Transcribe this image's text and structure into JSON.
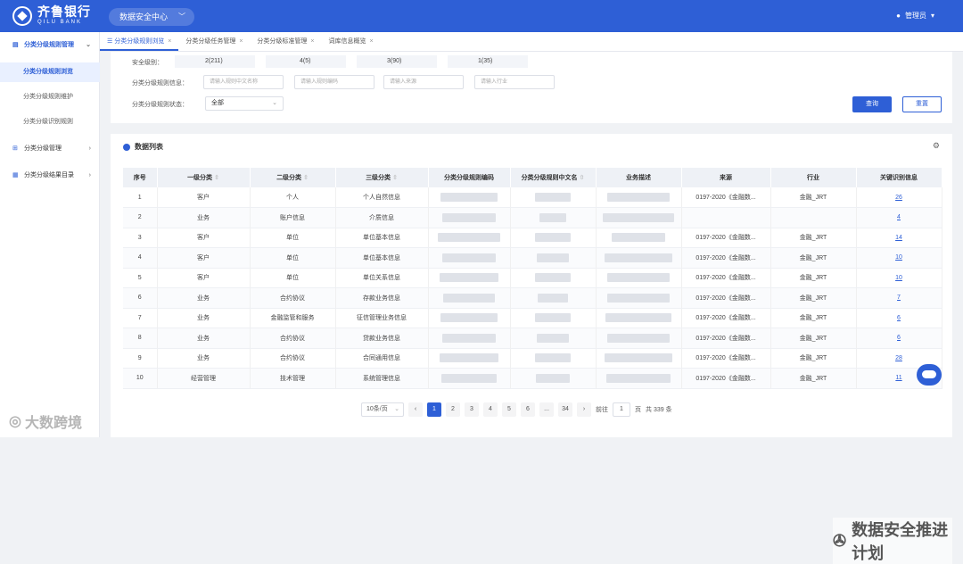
{
  "header": {
    "logo_cn": "齐鲁银行",
    "logo_en": "QILU BANK",
    "center_select": "数据安全中心",
    "user": "管理员"
  },
  "sidebar": {
    "items": [
      {
        "label": "分类分级规则管理",
        "type": "group",
        "open": true,
        "icon": "doc-icon"
      },
      {
        "label": "分类分级规则浏览",
        "type": "sub",
        "active": true
      },
      {
        "label": "分类分级规则维护",
        "type": "sub"
      },
      {
        "label": "分类分级识别规则",
        "type": "sub"
      },
      {
        "label": "分类分级管理",
        "type": "group",
        "icon": "grid-icon"
      },
      {
        "label": "分类分级结果目录",
        "type": "group",
        "icon": "list-icon"
      }
    ]
  },
  "tabs": [
    {
      "label": "分类分级规则浏览",
      "active": true
    },
    {
      "label": "分类分级任务管理"
    },
    {
      "label": "分类分级标准管理"
    },
    {
      "label": "词库信息概览"
    }
  ],
  "filter": {
    "level_label": "安全级别：",
    "levels": [
      "2(211)",
      "4(5)",
      "3(90)",
      "1(35)"
    ],
    "info_label": "分类分级规则信息：",
    "placeholders": [
      "请输入规则中文名称",
      "请输入规则编码",
      "请输入来源",
      "请输入行业"
    ],
    "status_label": "分类分级规则状态：",
    "status_value": "全部",
    "query_button": "查询",
    "reset_button": "重置"
  },
  "list": {
    "title": "数据列表",
    "columns": [
      "序号",
      "一级分类",
      "二级分类",
      "三级分类",
      "分类分级规则编码",
      "分类分级规则中文名",
      "业务描述",
      "来源",
      "行业",
      "关键识别信息"
    ],
    "rows": [
      {
        "no": "1",
        "l1": "客户",
        "l2": "个人",
        "l3": "个人自然信息",
        "source": "0197-2020《金融数...",
        "industry": "金融_JRT",
        "key": "26"
      },
      {
        "no": "2",
        "l1": "业务",
        "l2": "账户信息",
        "l3": "介质信息",
        "source": "",
        "industry": "",
        "key": "4"
      },
      {
        "no": "3",
        "l1": "客户",
        "l2": "单位",
        "l3": "单位基本信息",
        "source": "0197-2020《金融数...",
        "industry": "金融_JRT",
        "key": "14"
      },
      {
        "no": "4",
        "l1": "客户",
        "l2": "单位",
        "l3": "单位基本信息",
        "source": "0197-2020《金融数...",
        "industry": "金融_JRT",
        "key": "10"
      },
      {
        "no": "5",
        "l1": "客户",
        "l2": "单位",
        "l3": "单位关系信息",
        "source": "0197-2020《金融数...",
        "industry": "金融_JRT",
        "key": "10"
      },
      {
        "no": "6",
        "l1": "业务",
        "l2": "合约协议",
        "l3": "存款业务信息",
        "source": "0197-2020《金融数...",
        "industry": "金融_JRT",
        "key": "7"
      },
      {
        "no": "7",
        "l1": "业务",
        "l2": "金融监管和服务",
        "l3": "征信管理业务信息",
        "source": "0197-2020《金融数...",
        "industry": "金融_JRT",
        "key": "6"
      },
      {
        "no": "8",
        "l1": "业务",
        "l2": "合约协议",
        "l3": "贷款业务信息",
        "source": "0197-2020《金融数...",
        "industry": "金融_JRT",
        "key": "6"
      },
      {
        "no": "9",
        "l1": "业务",
        "l2": "合约协议",
        "l3": "合同通用信息",
        "source": "0197-2020《金融数...",
        "industry": "金融_JRT",
        "key": "28"
      },
      {
        "no": "10",
        "l1": "经营管理",
        "l2": "技术管理",
        "l3": "系统管理信息",
        "source": "0197-2020《金融数...",
        "industry": "金融_JRT",
        "key": "11"
      }
    ]
  },
  "pager": {
    "page_size": "10条/页",
    "pages": [
      "1",
      "2",
      "3",
      "4",
      "5",
      "6",
      "...",
      "34"
    ],
    "current": "1",
    "jump_label": "前往",
    "jump_value": "1",
    "page_unit": "页",
    "total": "共 339 条"
  },
  "watermarks": {
    "bottom_left": "大数跨境",
    "bottom_right": "数据安全推进计划"
  }
}
